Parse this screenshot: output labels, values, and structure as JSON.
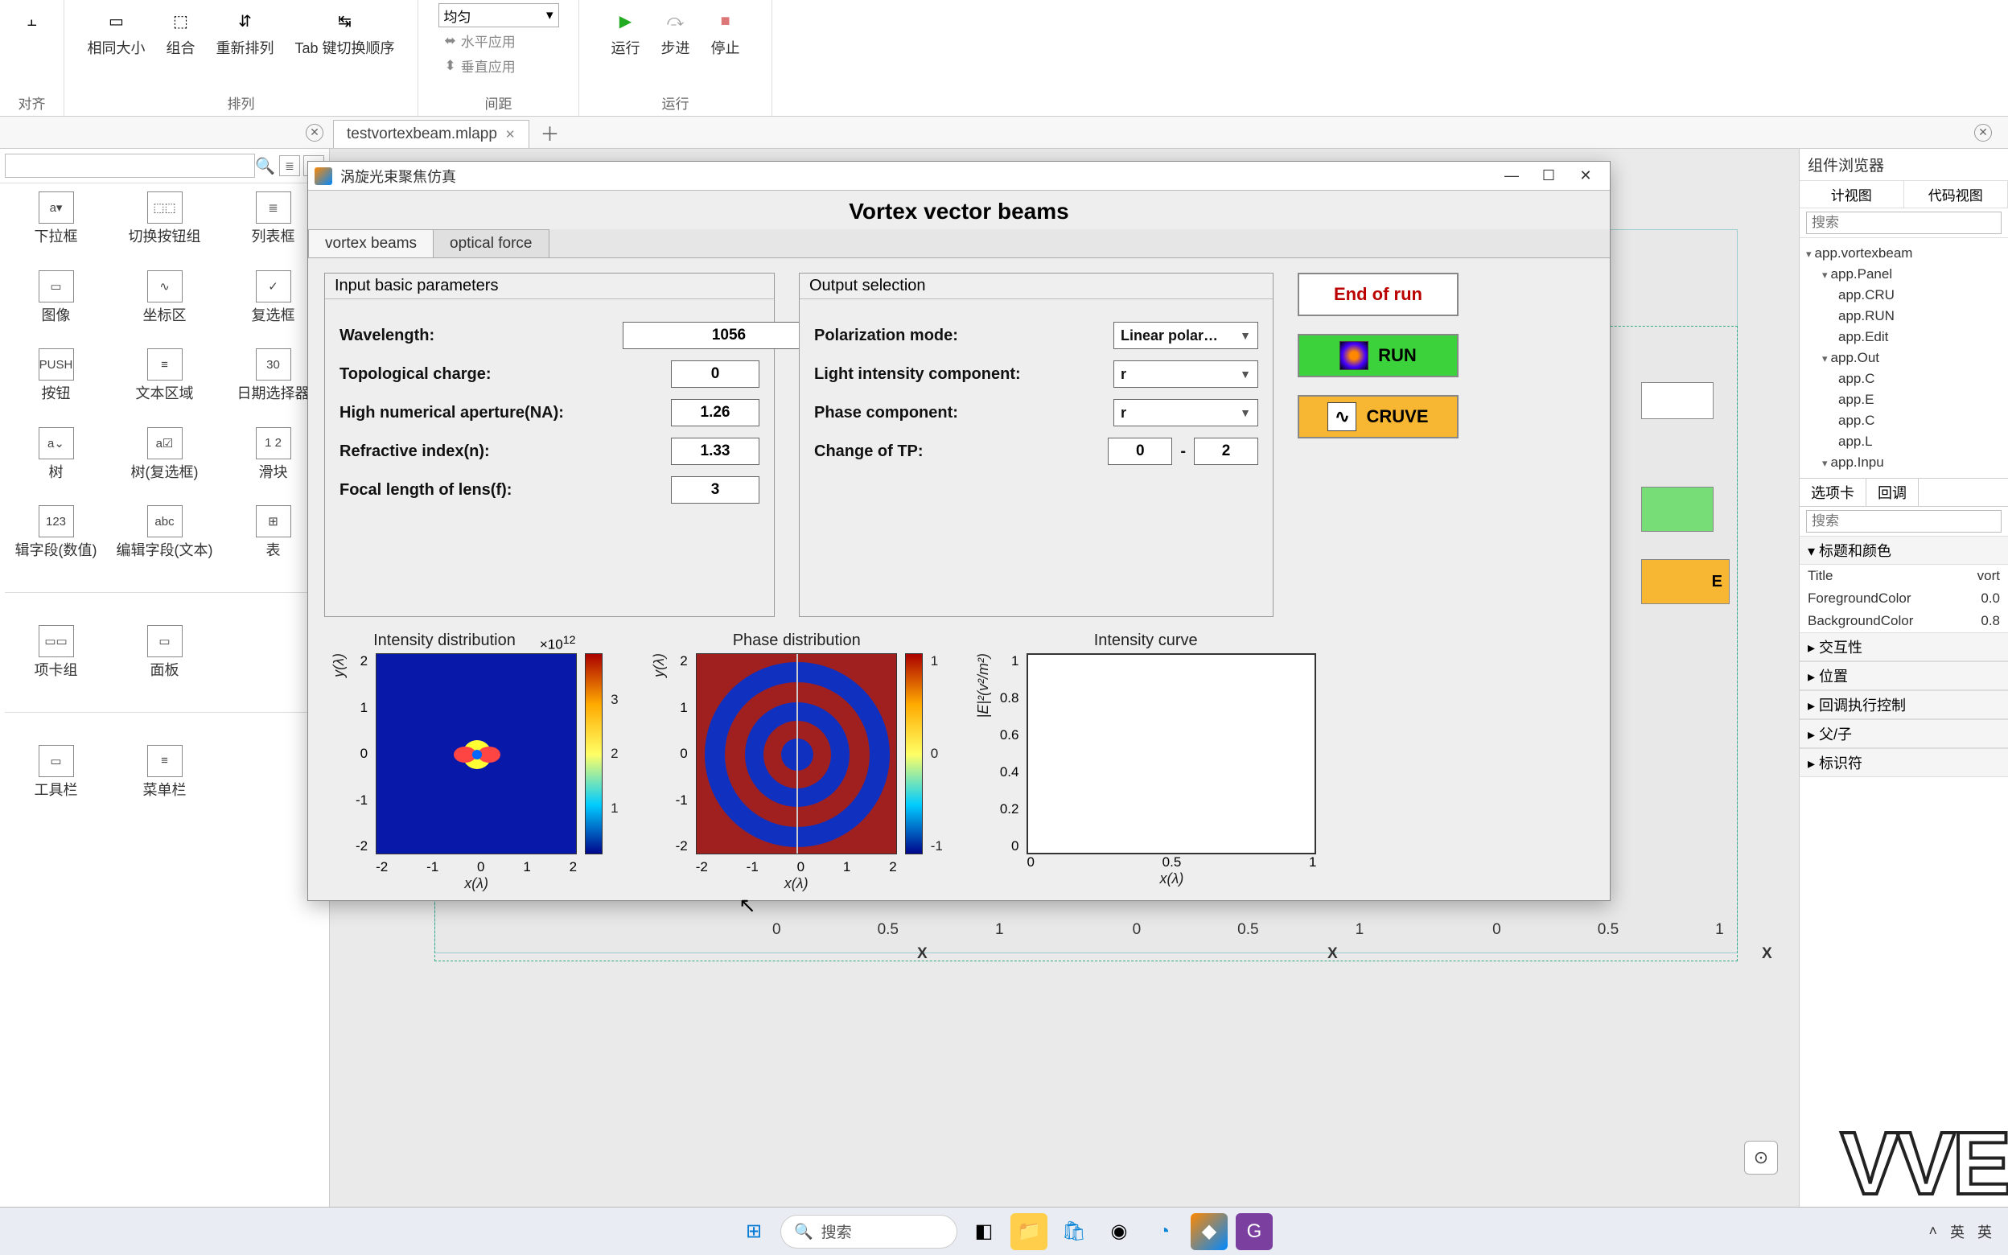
{
  "ribbon": {
    "groups": {
      "duiqi": {
        "label": "对齐",
        "btn1": "相同大小",
        "btn2": "组合",
        "btn3": "重新排列"
      },
      "pailie": {
        "label": "排列",
        "tab": "Tab 键切换顺序"
      },
      "jianju": {
        "label": "间距",
        "combo": "均匀",
        "h": "水平应用",
        "v": "垂直应用"
      },
      "yunxing": {
        "label": "运行",
        "run": "运行",
        "step": "步进",
        "stop": "停止"
      }
    }
  },
  "docTab": "testvortexbeam.mlapp",
  "palette": {
    "items": [
      [
        "下拉框",
        "切换按钮组",
        "列表框"
      ],
      [
        "图像",
        "坐标区",
        "复选框"
      ],
      [
        "按钮",
        "文本区域",
        "日期选择器"
      ],
      [
        "树",
        "树(复选框)",
        "滑块"
      ],
      [
        "辑字段(数值)",
        "编辑字段(文本)",
        "表"
      ],
      [
        "项卡组",
        "面板",
        ""
      ],
      [
        "工具栏",
        "菜单栏",
        ""
      ]
    ],
    "iconHints": [
      [
        "a▾",
        "⬚⬚",
        "≣"
      ],
      [
        "▭",
        "∿",
        "✓"
      ],
      [
        "PUSH",
        "≡",
        "30"
      ],
      [
        "a⌄",
        "a☑",
        "1 2"
      ],
      [
        "123",
        "abc",
        "⊞"
      ],
      [
        "▭▭",
        "▭",
        ""
      ],
      [
        "▭",
        "≡",
        ""
      ]
    ]
  },
  "appwin": {
    "title": "涡旋光束聚焦仿真",
    "header": "Vortex vector beams",
    "tabs": {
      "a": "vortex beams",
      "b": "optical force"
    },
    "inputPanel": {
      "title": "Input basic parameters",
      "wavelength_l": "Wavelength:",
      "wavelength_v": "1056",
      "topo_l": "Topological charge:",
      "topo_v": "0",
      "na_l": "High numerical aperture(NA):",
      "na_v": "1.26",
      "ri_l": "Refractive index(n):",
      "ri_v": "1.33",
      "fl_l": "Focal length of lens(f):",
      "fl_v": "3"
    },
    "outputPanel": {
      "title": "Output selection",
      "pol_l": "Polarization mode:",
      "pol_v": "Linear polar…",
      "lic_l": "Light intensity component:",
      "lic_v": "r",
      "phc_l": "Phase component:",
      "phc_v": "r",
      "tp_l": "Change of TP:",
      "tp_from": "0",
      "tp_dash": "-",
      "tp_to": "2"
    },
    "buttons": {
      "end": "End of run",
      "run": "RUN",
      "curve": "CRUVE"
    },
    "plots": {
      "intensity": {
        "title": "Intensity distribution",
        "exp": "×10",
        "exp_sup": "12",
        "xlabel": "x(λ)",
        "ylabel": "y(λ)"
      },
      "phase": {
        "title": "Phase distribution",
        "xlabel": "x(λ)",
        "ylabel": "y(λ)"
      },
      "curve": {
        "title": "Intensity curve",
        "xlabel": "x(λ)",
        "ylabel": "|E|²(v²/m²)"
      }
    }
  },
  "canvasBg": {
    "axisX": [
      "0",
      "0.5",
      "1",
      "0",
      "0.5",
      "1",
      "0",
      "0.5",
      "1"
    ],
    "axisXLabel": "X"
  },
  "browser": {
    "title": "组件浏览器",
    "search_ph": "搜索",
    "viewA": "计视图",
    "viewB": "代码视图",
    "tree": [
      {
        "l": 1,
        "t": "app.vortexbeam",
        "exp": "▾"
      },
      {
        "l": 2,
        "t": "app.Panel",
        "exp": "▾"
      },
      {
        "l": 3,
        "t": "app.CRU"
      },
      {
        "l": 3,
        "t": "app.RUN"
      },
      {
        "l": 3,
        "t": "app.Edit"
      },
      {
        "l": 2,
        "t": "app.Out",
        "exp": "▾"
      },
      {
        "l": 3,
        "t": "app.C"
      },
      {
        "l": 3,
        "t": "app.E"
      },
      {
        "l": 3,
        "t": "app.C"
      },
      {
        "l": 3,
        "t": "app.L"
      },
      {
        "l": 2,
        "t": "app.Inpu",
        "exp": "▾"
      }
    ],
    "propsTabs": {
      "a": "选项卡",
      "b": "回调"
    },
    "propsSearch_ph": "搜索",
    "sections": {
      "title": "标题和颜色",
      "title_k": "Title",
      "title_v": "vort",
      "fg_k": "ForegroundColor",
      "fg_v": "0.0",
      "bg_k": "BackgroundColor",
      "bg_v": "0.8",
      "interact": "交互性",
      "pos": "位置",
      "cb": "回调执行控制",
      "parent": "父/子",
      "ident": "标识符"
    }
  },
  "taskbar": {
    "search": "搜索",
    "ime1": "英",
    "ime2": "英"
  },
  "watermark": "VVE",
  "chart_data": [
    {
      "type": "heatmap",
      "title": "Intensity distribution",
      "xlabel": "x(λ)",
      "ylabel": "y(λ)",
      "xlim": [
        -2,
        2
      ],
      "ylim": [
        -2,
        2
      ],
      "xticks": [
        -2,
        -1,
        0,
        1,
        2
      ],
      "yticks": [
        -2,
        -1,
        0,
        1,
        2
      ],
      "colorbar_ticks": [
        1,
        2,
        3
      ],
      "scale": "×10^12",
      "note": "focused double-lobe spot near origin, background ~0"
    },
    {
      "type": "heatmap",
      "title": "Phase distribution",
      "xlabel": "x(λ)",
      "ylabel": "y(λ)",
      "xlim": [
        -2,
        2
      ],
      "ylim": [
        -2,
        2
      ],
      "xticks": [
        -2,
        -1,
        0,
        1,
        2
      ],
      "yticks": [
        -2,
        -1,
        0,
        1,
        2
      ],
      "colorbar_ticks": [
        -1,
        0,
        1
      ],
      "note": "concentric alternating rings, vertical discontinuity at x=0"
    },
    {
      "type": "line",
      "title": "Intensity curve",
      "xlabel": "x(λ)",
      "ylabel": "|E|²(v²/m²)",
      "xlim": [
        0,
        1
      ],
      "ylim": [
        0,
        1
      ],
      "xticks": [
        0,
        0.5,
        1
      ],
      "yticks": [
        0,
        0.2,
        0.4,
        0.6,
        0.8,
        1
      ],
      "series": [
        {
          "name": "curve",
          "values": []
        }
      ],
      "note": "empty axes, no data plotted yet"
    }
  ]
}
